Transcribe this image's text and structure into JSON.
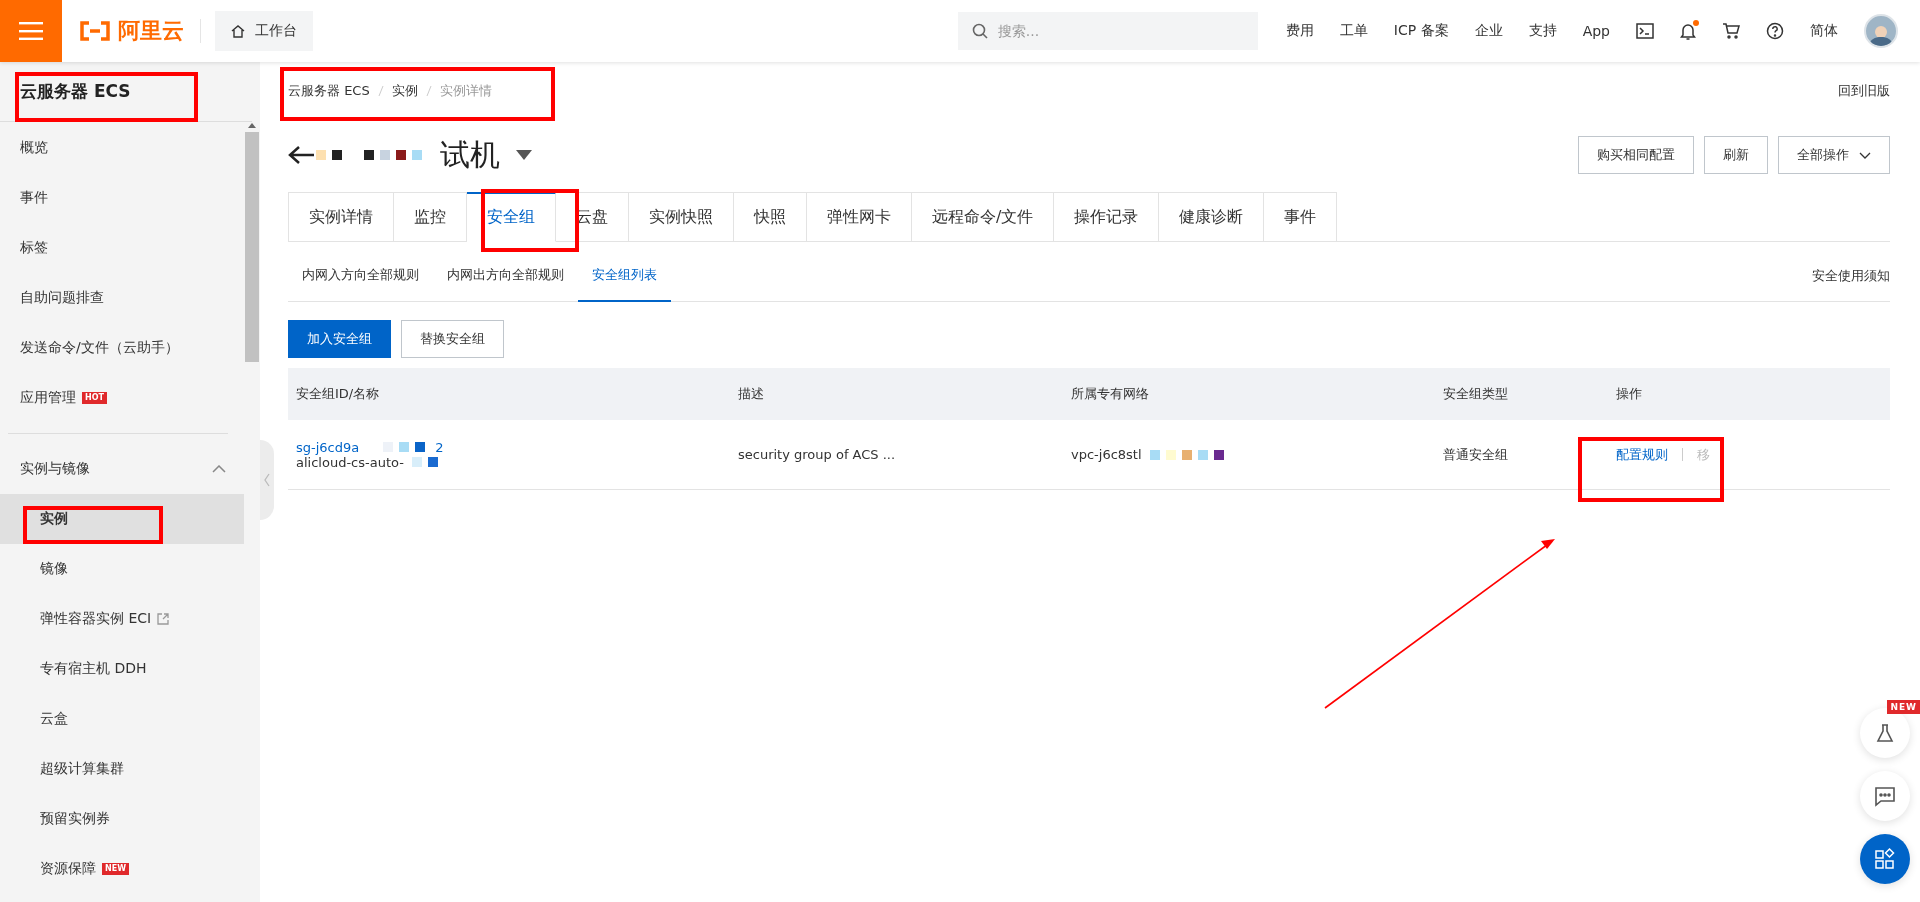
{
  "topbar": {
    "brand": "阿里云",
    "workbench": "工作台",
    "search": {
      "placeholder": "搜索..."
    },
    "links": [
      "费用",
      "工单",
      "ICP 备案",
      "企业",
      "支持",
      "App"
    ],
    "notification_unread": true,
    "language": "简体"
  },
  "sidebar": {
    "title": "云服务器 ECS",
    "items": [
      {
        "label": "概览",
        "selected": false
      },
      {
        "label": "事件",
        "selected": false
      },
      {
        "label": "标签",
        "selected": false
      },
      {
        "label": "自助问题排查",
        "selected": false
      },
      {
        "label": "发送命令/文件（云助手）",
        "selected": false
      },
      {
        "label": "应用管理",
        "badge": "HOT",
        "selected": false
      }
    ],
    "sections": [
      {
        "label": "实例与镜像",
        "expanded": true,
        "children": [
          {
            "label": "实例",
            "selected": true
          },
          {
            "label": "镜像",
            "selected": false
          },
          {
            "label": "弹性容器实例 ECI",
            "external": true,
            "selected": false
          },
          {
            "label": "专有宿主机 DDH",
            "selected": false
          },
          {
            "label": "云盒",
            "selected": false
          },
          {
            "label": "超级计算集群",
            "selected": false
          },
          {
            "label": "预留实例券",
            "selected": false
          },
          {
            "label": "资源保障",
            "badge": "NEW",
            "selected": false
          }
        ]
      }
    ]
  },
  "breadcrumb": [
    "云服务器 ECS",
    "实例",
    "实例详情"
  ],
  "old_version_link": "回到旧版",
  "title": "试机",
  "actions": [
    "购买相同配置",
    "刷新",
    "全部操作"
  ],
  "tabs": [
    {
      "label": "实例详情",
      "selected": false
    },
    {
      "label": "监控",
      "selected": false
    },
    {
      "label": "安全组",
      "selected": true
    },
    {
      "label": "云盘",
      "selected": false
    },
    {
      "label": "实例快照",
      "selected": false
    },
    {
      "label": "快照",
      "selected": false
    },
    {
      "label": "弹性网卡",
      "selected": false
    },
    {
      "label": "远程命令/文件",
      "selected": false
    },
    {
      "label": "操作记录",
      "selected": false
    },
    {
      "label": "健康诊断",
      "selected": false
    },
    {
      "label": "事件",
      "selected": false
    }
  ],
  "subtabs": [
    {
      "label": "内网入方向全部规则",
      "selected": false
    },
    {
      "label": "内网出方向全部规则",
      "selected": false
    },
    {
      "label": "安全组列表",
      "selected": true
    }
  ],
  "security_notice_link": "安全使用须知",
  "buttons": [
    {
      "label": "加入安全组",
      "kind": "primary"
    },
    {
      "label": "替换安全组",
      "kind": "default"
    }
  ],
  "table": {
    "columns": [
      "安全组ID/名称",
      "描述",
      "所属专有网络",
      "安全组类型",
      "操作"
    ],
    "rows": [
      {
        "id": "sg-j6cd9a",
        "id_suffix": "2",
        "name": "alicloud-cs-auto-",
        "description": "security group of ACS ...",
        "vpc": "vpc-j6c8stl",
        "type": "普通安全组",
        "actions": [
          {
            "label": "配置规则",
            "disabled": false
          },
          {
            "label": "移",
            "disabled": true
          }
        ]
      }
    ]
  },
  "float_buttons": [
    {
      "kind": "lab",
      "badge": "NEW"
    },
    {
      "kind": "chat"
    },
    {
      "kind": "apps"
    }
  ]
}
